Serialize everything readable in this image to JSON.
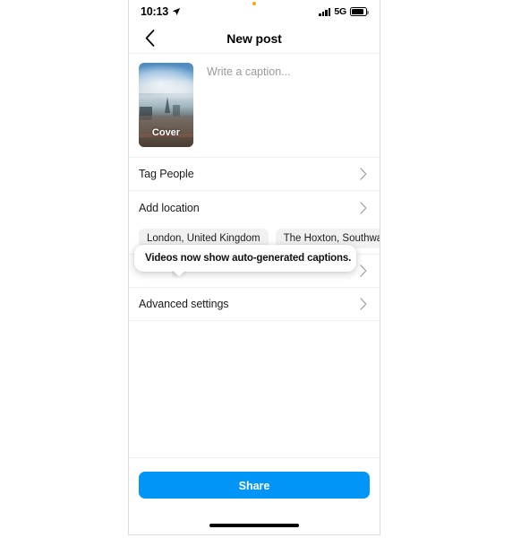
{
  "status_bar": {
    "time": "10:13",
    "location_icon": "location-arrow-icon",
    "signal_icon": "cellular-signal-icon",
    "network": "5G",
    "battery_icon": "battery-icon"
  },
  "nav": {
    "back_icon": "chevron-left-icon",
    "title": "New post"
  },
  "composer": {
    "thumbnail_label": "Cover",
    "thumbnail_alt": "city-skyline-thumbnail",
    "caption_placeholder": "Write a caption...",
    "caption_value": ""
  },
  "rows": [
    {
      "label": "Tag People",
      "chevron": "chevron-right-icon"
    },
    {
      "label": "Add location",
      "chevron": "chevron-right-icon"
    },
    {
      "label": "",
      "chevron": "chevron-right-icon"
    },
    {
      "label": "Advanced settings",
      "chevron": "chevron-right-icon"
    }
  ],
  "location_chips": [
    {
      "label": "London, United Kingdom"
    },
    {
      "label": "The Hoxton, Southwark"
    }
  ],
  "tooltip": {
    "text": "Videos now show auto-generated captions."
  },
  "share": {
    "label": "Share",
    "color": "#0095f6"
  },
  "colors": {
    "accent": "#0095f6",
    "divider": "#efefef",
    "chip_bg": "#f1f1f1",
    "text": "#1b1b1b",
    "placeholder": "#9a9a9a",
    "status_dot": "#f5a623"
  }
}
